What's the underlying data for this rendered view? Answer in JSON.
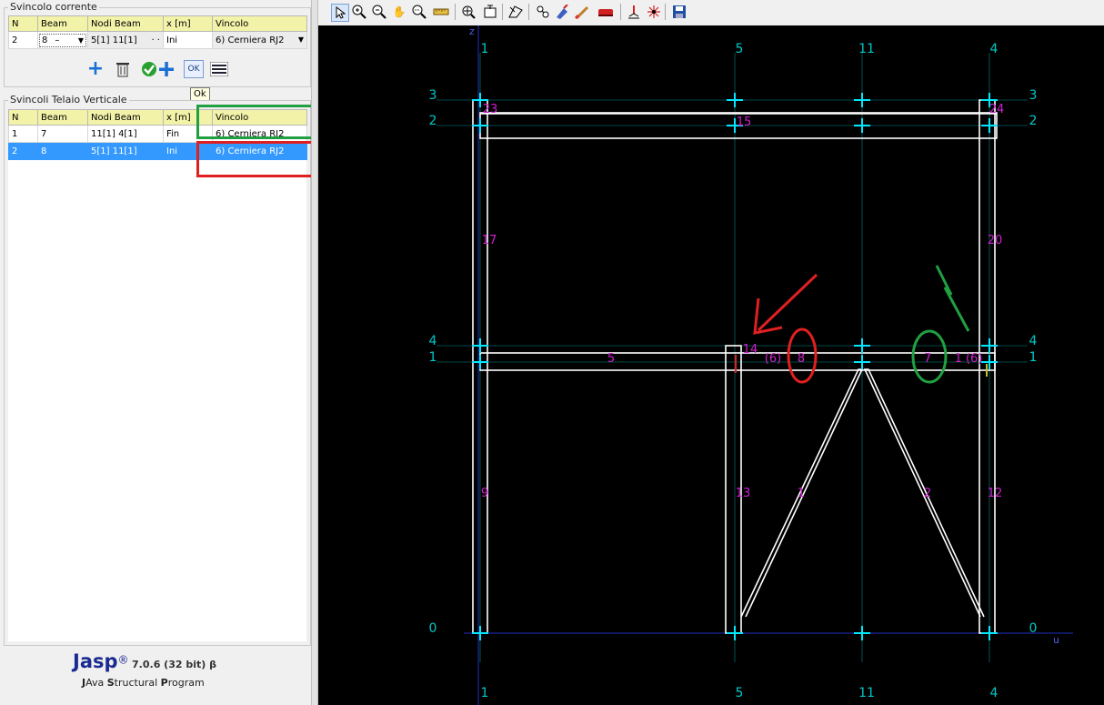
{
  "current_constraint": {
    "title": "Svincolo corrente",
    "columns": [
      "N",
      "Beam",
      "Nodi Beam",
      "x [m]",
      "Vincolo"
    ],
    "row": {
      "n": "2",
      "beam": "8",
      "beam_suffix": "–",
      "nodes": "5[1]  11[1]",
      "nodes_suffix": "· ·",
      "x": "Ini",
      "vincolo": "6) Cerniera RJ2"
    }
  },
  "tooltip": "Ok",
  "ok_button_label": "OK",
  "frame_constraints": {
    "title": "Svincoli Telaio Verticale",
    "columns": [
      "N",
      "Beam",
      "Nodi Beam",
      "x [m]",
      "Vincolo"
    ],
    "rows": [
      {
        "n": "1",
        "beam": "7",
        "nodes": "11[1]  4[1]",
        "x": "Fin",
        "vincolo": "6) Cerniera RJ2",
        "selected": false
      },
      {
        "n": "2",
        "beam": "8",
        "nodes": "5[1]  11[1]",
        "x": "Ini",
        "vincolo": "6) Cerniera RJ2",
        "selected": true
      }
    ]
  },
  "brand": {
    "name": "Jasp",
    "reg": "®",
    "version": "7.0.6 (32 bit) β",
    "tagline_parts": [
      "J",
      "Ava ",
      "S",
      "tructural ",
      "P",
      "rogram"
    ]
  },
  "toolbar": {
    "icons": [
      "pointer-icon",
      "zoom-in-icon",
      "zoom-out-icon",
      "pan-icon",
      "zoom-window-icon",
      "measure-icon",
      "zoom-fit-icon",
      "zoom-extents-icon",
      "rotate-icon",
      "nodes-icon",
      "paint-icon",
      "brush-icon",
      "color-icon",
      "support-icon",
      "star-node-icon",
      "save-icon"
    ]
  },
  "model": {
    "axis_z": "z",
    "axis_u": "u",
    "col_labels_top": [
      "1",
      "5",
      "11",
      "4"
    ],
    "col_labels_bottom": [
      "1",
      "5",
      "11",
      "4"
    ],
    "row_labels_left": [
      "3",
      "2",
      "4",
      "1",
      "0"
    ],
    "row_labels_right": [
      "3",
      "2",
      "4",
      "1",
      "0"
    ],
    "beam_labels": [
      "23",
      "15",
      "24",
      "17",
      "20",
      "5",
      "14",
      "(6)",
      "8",
      "7",
      "1 (6)",
      "9",
      "13",
      "1",
      "2",
      "12"
    ],
    "colors": {
      "grid": "#00c8c8",
      "grid_dark": "#2030c0",
      "beam": "#ffffff",
      "beam_label": "#d020d0",
      "node": "#00e8ff",
      "red": "#e02020",
      "green": "#20a040"
    }
  }
}
